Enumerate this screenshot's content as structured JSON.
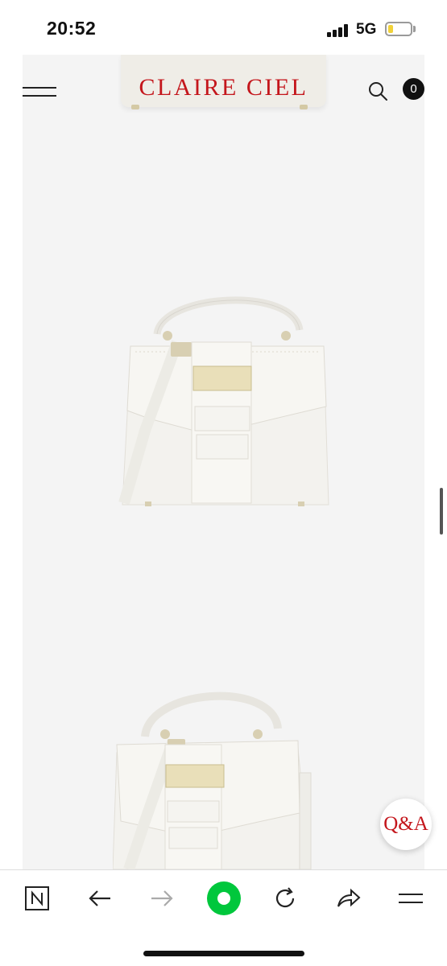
{
  "status_bar": {
    "time": "20:52",
    "network": "5G"
  },
  "header": {
    "brand": "CLAIRE CIEL",
    "cart_count": "0"
  },
  "product": {
    "image_1": "white-top-handle-bag-front",
    "image_2": "white-top-handle-bag-angled"
  },
  "floating": {
    "qa_label": "Q&A"
  },
  "browser_toolbar": {
    "icons": [
      "naver-n-icon",
      "back-arrow-icon",
      "forward-arrow-icon",
      "green-dot-icon",
      "reload-icon",
      "share-icon",
      "menu-icon"
    ],
    "accent_color": "#00c73c"
  },
  "colors": {
    "brand_red": "#c4161c",
    "background": "#f4f4f4"
  }
}
